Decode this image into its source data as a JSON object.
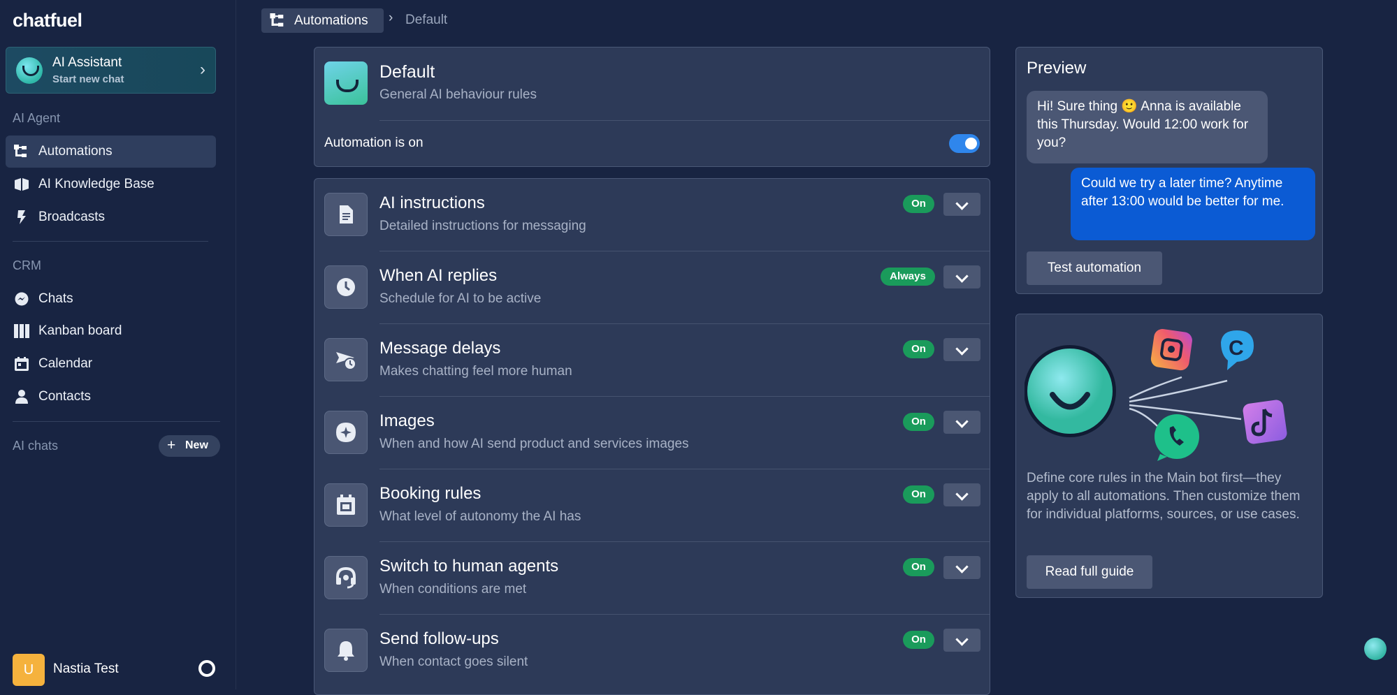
{
  "app": {
    "logo": "chatfuel"
  },
  "sidebar": {
    "ai_card": {
      "title": "AI Assistant",
      "subtitle": "Start new chat"
    },
    "sections": [
      {
        "label": "AI Agent",
        "items": [
          {
            "label": "Automations",
            "icon": "automations-icon",
            "active": true
          },
          {
            "label": "AI Knowledge Base",
            "icon": "knowledge-base-icon"
          },
          {
            "label": "Broadcasts",
            "icon": "broadcast-icon"
          }
        ]
      },
      {
        "label": "CRM",
        "items": [
          {
            "label": "Chats",
            "icon": "messenger-icon"
          },
          {
            "label": "Kanban board",
            "icon": "kanban-icon"
          },
          {
            "label": "Calendar",
            "icon": "calendar-icon"
          },
          {
            "label": "Contacts",
            "icon": "contacts-icon"
          }
        ]
      }
    ],
    "ai_chats": {
      "label": "AI chats",
      "new_label": "New"
    },
    "user": {
      "initial": "U",
      "name": "Nastia Test"
    }
  },
  "breadcrumb": {
    "root": "Automations",
    "separator": "›",
    "current": "Default"
  },
  "default_card": {
    "title": "Default",
    "subtitle": "General AI behaviour rules",
    "status_label": "Automation is on",
    "enabled": true
  },
  "rules": [
    {
      "title": "AI instructions",
      "subtitle": "Detailed instructions for messaging",
      "badge": "On",
      "icon": "document-icon"
    },
    {
      "title": "When AI replies",
      "subtitle": "Schedule for AI to be active",
      "badge": "Always",
      "icon": "clock-icon"
    },
    {
      "title": "Message delays",
      "subtitle": "Makes chatting feel more human",
      "badge": "On",
      "icon": "delay-icon"
    },
    {
      "title": "Images",
      "subtitle": "When and how AI send product and services images",
      "badge": "On",
      "icon": "image-sparkle-icon"
    },
    {
      "title": "Booking rules",
      "subtitle": "What level of autonomy the AI has",
      "badge": "On",
      "icon": "calendar-icon"
    },
    {
      "title": "Switch to human agents",
      "subtitle": "When conditions are met",
      "badge": "On",
      "icon": "headset-icon"
    },
    {
      "title": "Send follow-ups",
      "subtitle": "When contact goes silent",
      "badge": "On",
      "icon": "bell-icon"
    }
  ],
  "preview": {
    "title": "Preview",
    "incoming": "Hi! Sure thing 🙂 Anna is available this Thursday. Would 12:00 work for you?",
    "outgoing": "Could we try a later time? Anytime after 13:00 would be better for me.",
    "button": "Test automation"
  },
  "guide": {
    "text": "Define core rules in the Main bot first—they apply to all automations. Then customize them for individual platforms, sources, or use cases.",
    "button": "Read full guide"
  },
  "colors": {
    "accent": "#2f86ec",
    "badge_green": "#1a9b5b",
    "outgoing_bubble": "#0b5bd4",
    "background": "#182442"
  }
}
